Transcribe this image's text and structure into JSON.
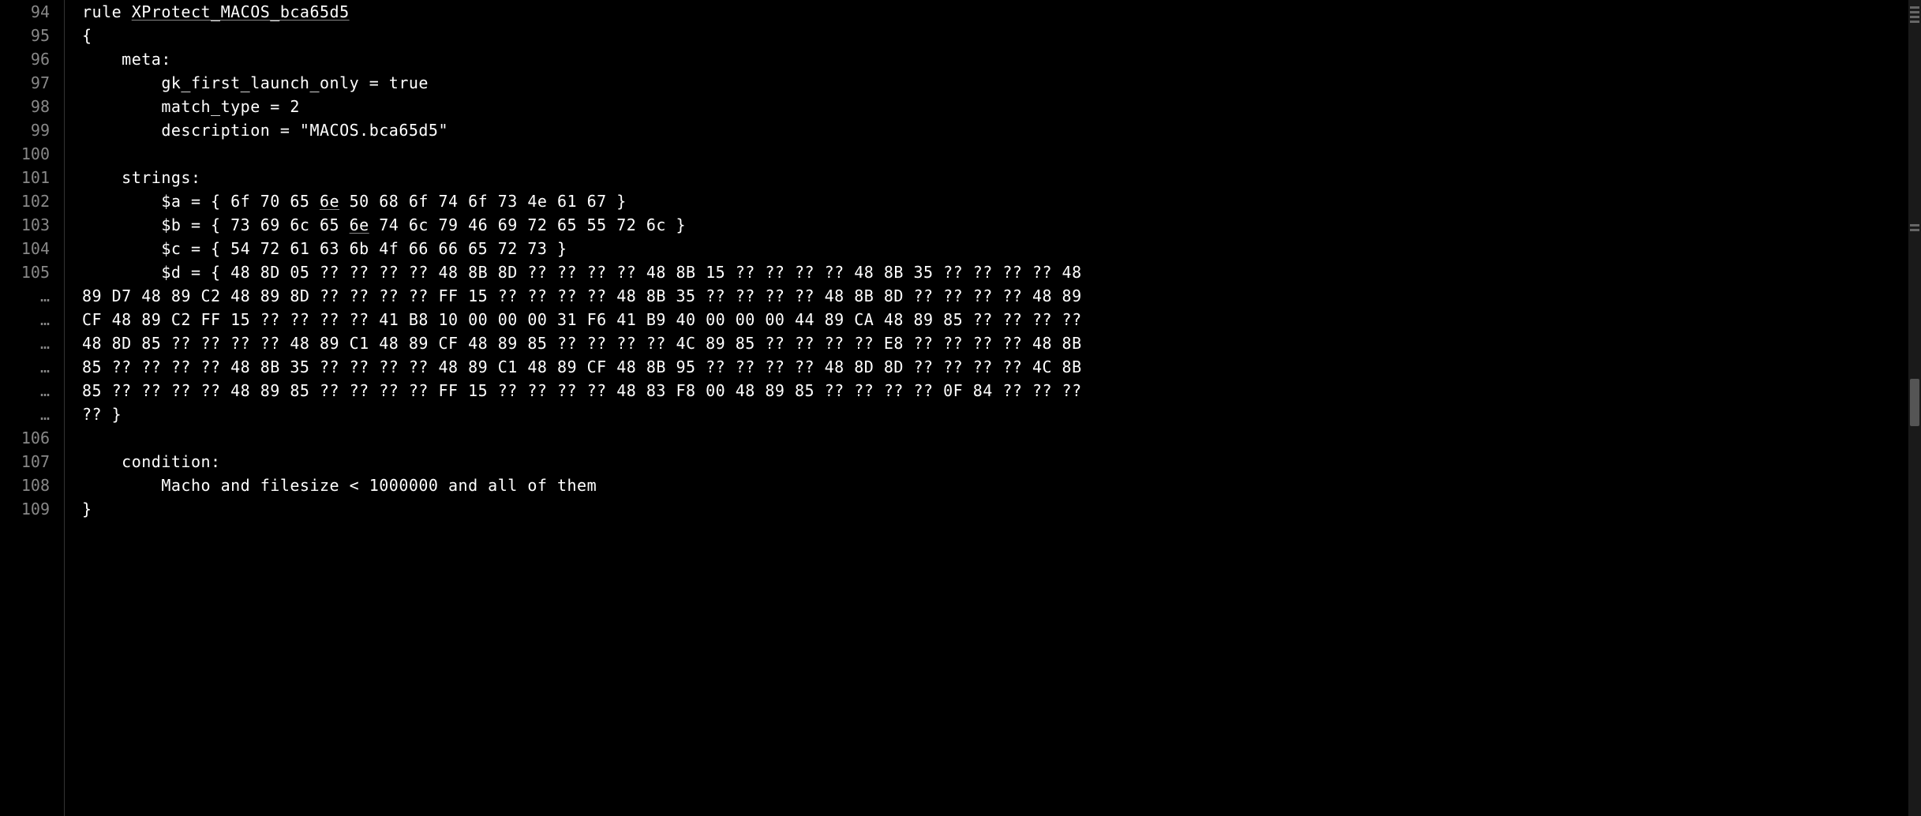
{
  "lines": [
    {
      "num": "94",
      "content": "rule ",
      "underlined": "XProtect_MACOS_bca65d5",
      "after": ""
    },
    {
      "num": "95",
      "content": "{"
    },
    {
      "num": "96",
      "content": "    meta:"
    },
    {
      "num": "97",
      "content": "        gk_first_launch_only = true"
    },
    {
      "num": "98",
      "content": "        match_type = 2"
    },
    {
      "num": "99",
      "content": "        description = \"MACOS.bca65d5\""
    },
    {
      "num": "100",
      "content": ""
    },
    {
      "num": "101",
      "content": "    strings:"
    },
    {
      "num": "102",
      "content": "        $a = { 6f 70 65 ",
      "underlined": "6e",
      "after": " 50 68 6f 74 6f 73 4e 61 67 }"
    },
    {
      "num": "103",
      "content": "        $b = { 73 69 6c 65 ",
      "underlined": "6e",
      "after": " 74 6c 79 46 69 72 65 55 72 6c }"
    },
    {
      "num": "104",
      "content": "        $c = { 54 72 61 63 6b 4f 66 66 65 72 73 }"
    },
    {
      "num": "105",
      "content": "        $d = { 48 8D 05 ?? ?? ?? ?? 48 8B 8D ?? ?? ?? ?? 48 8B 15 ?? ?? ?? ?? 48 8B 35 ?? ?? ?? ?? 48"
    },
    {
      "num": "…",
      "content": "89 D7 48 89 C2 48 89 8D ?? ?? ?? ?? FF 15 ?? ?? ?? ?? 48 8B 35 ?? ?? ?? ?? 48 8B 8D ?? ?? ?? ?? 48 89"
    },
    {
      "num": "…",
      "content": "CF 48 89 C2 FF 15 ?? ?? ?? ?? 41 B8 10 00 00 00 31 F6 41 B9 40 00 00 00 44 89 CA 48 89 85 ?? ?? ?? ??"
    },
    {
      "num": "…",
      "content": "48 8D 85 ?? ?? ?? ?? 48 89 C1 48 89 CF 48 89 85 ?? ?? ?? ?? 4C 89 85 ?? ?? ?? ?? E8 ?? ?? ?? ?? 48 8B"
    },
    {
      "num": "…",
      "content": "85 ?? ?? ?? ?? 48 8B 35 ?? ?? ?? ?? 48 89 C1 48 89 CF 48 8B 95 ?? ?? ?? ?? 48 8D 8D ?? ?? ?? ?? 4C 8B"
    },
    {
      "num": "…",
      "content": "85 ?? ?? ?? ?? 48 89 85 ?? ?? ?? ?? FF 15 ?? ?? ?? ?? 48 83 F8 00 48 89 85 ?? ?? ?? ?? 0F 84 ?? ?? ??"
    },
    {
      "num": "…",
      "content": "?? }"
    },
    {
      "num": "106",
      "content": ""
    },
    {
      "num": "107",
      "content": "    condition:"
    },
    {
      "num": "108",
      "content": "        Macho and filesize < 1000000 and all of them"
    },
    {
      "num": "109",
      "content": "}"
    }
  ]
}
